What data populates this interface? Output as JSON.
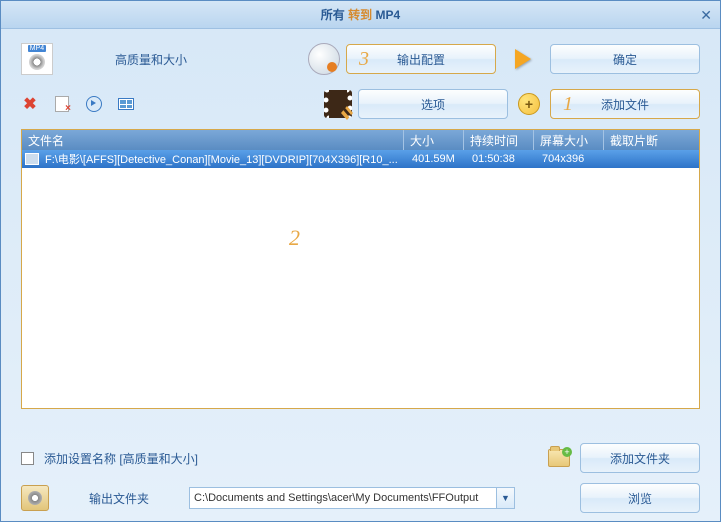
{
  "title": {
    "prefix": "所有",
    "mid": "转到",
    "suffix": "MP4"
  },
  "quality_label": "高质量和大小",
  "top_buttons": {
    "output_config": "输出配置",
    "ok": "确定"
  },
  "second_buttons": {
    "options": "选项",
    "add_file": "添加文件"
  },
  "numbers": {
    "one": "1",
    "two": "2",
    "three": "3"
  },
  "table": {
    "headers": {
      "name": "文件名",
      "size": "大小",
      "duration": "持续时间",
      "dimensions": "屏幕大小",
      "crop": "截取片断"
    },
    "rows": [
      {
        "name": "F:\\电影\\[AFFS][Detective_Conan][Movie_13][DVDRIP][704X396][R10_...",
        "size": "401.59M",
        "duration": "01:50:38",
        "dimensions": "704x396",
        "crop": ""
      }
    ]
  },
  "footer": {
    "add_settings_label": "添加设置名称 [高质量和大小]",
    "add_folder": "添加文件夹",
    "output_folder_label": "输出文件夹",
    "output_path": "C:\\Documents and Settings\\acer\\My Documents\\FFOutput",
    "browse": "浏览"
  }
}
